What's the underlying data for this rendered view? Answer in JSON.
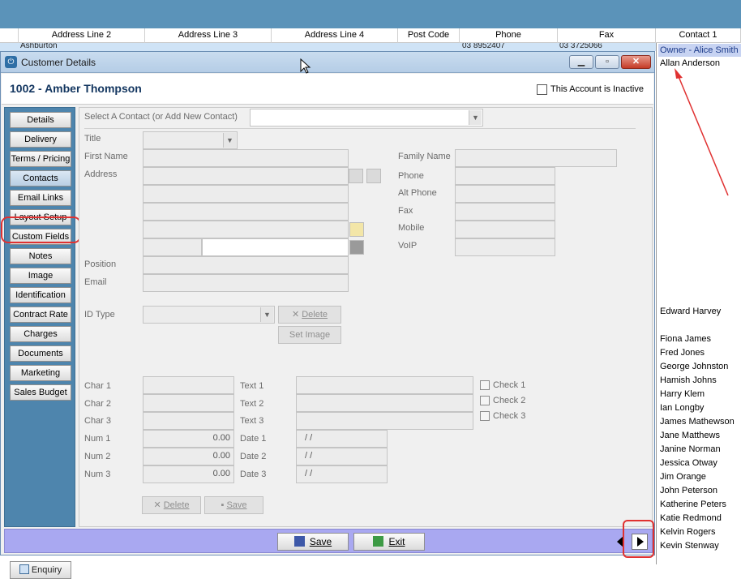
{
  "grid": {
    "columns": [
      "Address Line 2",
      "Address Line 3",
      "Address Line 4",
      "Post Code",
      "Phone",
      "Fax",
      "Contact 1"
    ],
    "row1": {
      "address2": "Ashburton",
      "phone": "03 8952407",
      "fax": "03 3725066"
    }
  },
  "contacts_panel": {
    "owner": "Owner -  Alice Smith",
    "first": "Allan Anderson",
    "names": [
      "Edward Harvey",
      "Fiona James",
      "Fred Jones",
      "George Johnston",
      "Hamish Johns",
      "Harry Klem",
      "Ian Longby",
      "James Mathewson",
      "Jane Matthews",
      "Janine Norman",
      "Jessica Otway",
      "Jim Orange",
      "John Peterson",
      "Katherine Peters",
      "Katie Redmond",
      "Kelvin Rogers",
      "Kevin Stenway"
    ]
  },
  "window": {
    "title": "Customer Details",
    "icon": "power-icon",
    "account_title": "1002 - Amber Thompson",
    "inactive_label": "This Account is Inactive"
  },
  "nav": {
    "items": [
      "Details",
      "Delivery",
      "Terms / Pricing",
      "Contacts",
      "Email Links",
      "Layout Setup",
      "Custom Fields",
      "Notes",
      "Image",
      "Identification",
      "Contract Rate",
      "Charges",
      "Documents",
      "Marketing",
      "Sales Budget"
    ],
    "active": "Contacts",
    "enquiry": "Enquiry"
  },
  "form": {
    "select_contact_label": "Select A Contact (or Add New Contact)",
    "title_label": "Title",
    "first_name_label": "First Name",
    "family_name_label": "Family Name",
    "address_label": "Address",
    "phone_label": "Phone",
    "alt_phone_label": "Alt Phone",
    "fax_label": "Fax",
    "mobile_label": "Mobile",
    "voip_label": "VoIP",
    "position_label": "Position",
    "email_label": "Email",
    "id_type_label": "ID Type",
    "delete_label": "Delete",
    "set_image_label": "Set Image",
    "char_labels": [
      "Char 1",
      "Char 2",
      "Char 3"
    ],
    "text_labels": [
      "Text 1",
      "Text 2",
      "Text 3"
    ],
    "check_labels": [
      "Check 1",
      "Check 2",
      "Check 3"
    ],
    "num_labels": [
      "Num 1",
      "Num 2",
      "Num 3"
    ],
    "num_values": [
      "0.00",
      "0.00",
      "0.00"
    ],
    "date_labels": [
      "Date 1",
      "Date 2",
      "Date 3"
    ],
    "date_values": [
      " /  /",
      " /  /",
      " /  /"
    ],
    "bottom_delete": "Delete",
    "bottom_save": "Save"
  },
  "footer": {
    "save": "Save",
    "exit": "Exit"
  },
  "colors": {
    "topband": "#5b93b9",
    "nav": "#4e85ad",
    "bottombar": "#a9a8f1",
    "highlight": "#e03131"
  }
}
